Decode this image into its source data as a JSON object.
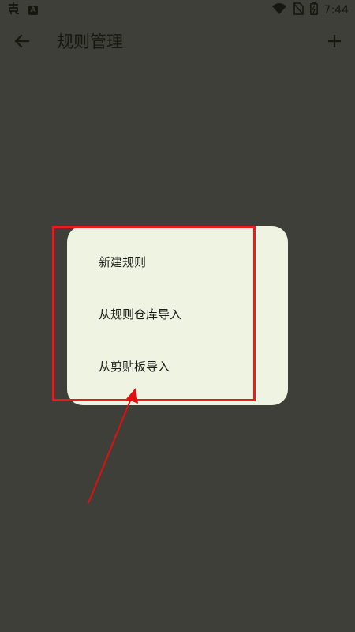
{
  "status_bar": {
    "time": "7:44",
    "left_icons": [
      "app-notification-icon",
      "a-badge-icon"
    ],
    "right_icons": [
      "wifi-icon",
      "no-sim-icon",
      "battery-icon"
    ]
  },
  "app_bar": {
    "title": "规则管理",
    "back_icon": "arrow-left-icon",
    "add_icon": "plus-icon"
  },
  "menu": {
    "items": [
      {
        "label": "新建规则"
      },
      {
        "label": "从规则仓库导入"
      },
      {
        "label": "从剪贴板导入"
      }
    ]
  },
  "annotation": {
    "highlight_color": "#f01818",
    "arrow_color": "#e01010"
  },
  "colors": {
    "scrim": "#3e3f38",
    "menu_background": "#eff3e2",
    "text": "#1b1c18"
  }
}
